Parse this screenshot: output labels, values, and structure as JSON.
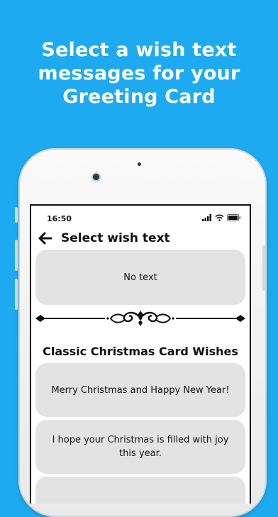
{
  "promo": {
    "headline_line1": "Select a wish text",
    "headline_line2": "messages for your",
    "headline_line3": "Greeting Card"
  },
  "status_bar": {
    "time": "16:50",
    "icons": [
      "signal-icon",
      "wifi-icon",
      "battery-icon"
    ]
  },
  "navbar": {
    "back_icon": "arrow-left-icon",
    "title": "Select wish text"
  },
  "options": {
    "no_text": "No text"
  },
  "section": {
    "title": "Classic Christmas Card Wishes"
  },
  "wishes": [
    "Merry Christmas and Happy New Year!",
    "I hope your Christmas is filled with joy this year."
  ],
  "colors": {
    "background": "#1eaaf1",
    "card": "#e3e3e3",
    "text": "#111111"
  }
}
